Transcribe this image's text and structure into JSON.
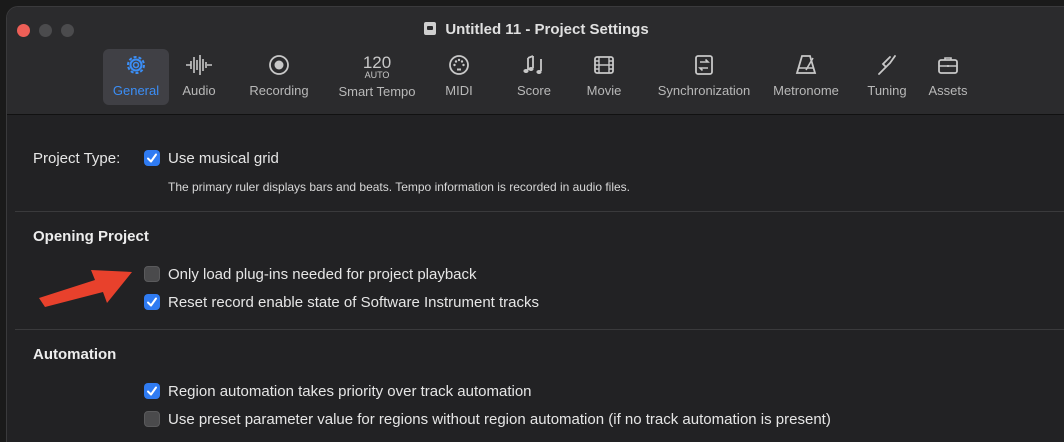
{
  "window": {
    "title": "Untitled 11 - Project Settings"
  },
  "tabs": [
    {
      "label": "General",
      "icon": "gear-icon"
    },
    {
      "label": "Audio",
      "icon": "waveform-icon"
    },
    {
      "label": "Recording",
      "icon": "record-icon"
    },
    {
      "label": "Smart Tempo",
      "icon": "tempo-icon",
      "top": "120",
      "sub": "AUTO"
    },
    {
      "label": "MIDI",
      "icon": "midi-port-icon"
    },
    {
      "label": "Score",
      "icon": "notes-icon"
    },
    {
      "label": "Movie",
      "icon": "film-icon"
    },
    {
      "label": "Synchronization",
      "icon": "sync-icon"
    },
    {
      "label": "Metronome",
      "icon": "metronome-icon"
    },
    {
      "label": "Tuning",
      "icon": "tuning-fork-icon"
    },
    {
      "label": "Assets",
      "icon": "briefcase-icon"
    }
  ],
  "general": {
    "project_type_label": "Project Type:",
    "musical_grid": {
      "label": "Use musical grid",
      "checked": true
    },
    "musical_grid_note": "The primary ruler displays bars and beats. Tempo information is recorded in audio files.",
    "opening_project": {
      "heading": "Opening Project",
      "options": [
        {
          "label": "Only load plug-ins needed for project playback",
          "checked": false
        },
        {
          "label": "Reset record enable state of Software Instrument tracks",
          "checked": true
        }
      ]
    },
    "automation": {
      "heading": "Automation",
      "options": [
        {
          "label": "Region automation takes priority over track automation",
          "checked": true
        },
        {
          "label": "Use preset parameter value for regions without region automation (if no track automation is present)",
          "checked": false
        }
      ]
    }
  },
  "colors": {
    "accent": "#2f7bf2",
    "annotation_arrow": "#e8412c",
    "close": "#ed5f57"
  }
}
